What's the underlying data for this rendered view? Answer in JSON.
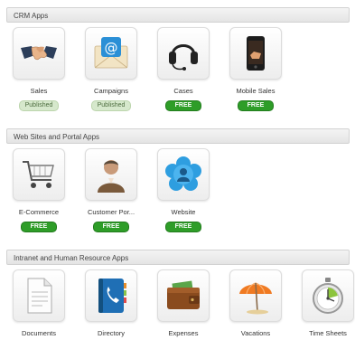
{
  "sections": [
    {
      "title": "CRM Apps"
    },
    {
      "title": "Web Sites and Portal Apps"
    },
    {
      "title": "Intranet and Human Resource Apps"
    }
  ],
  "crm_apps": [
    {
      "name": "Sales",
      "badge": "Published",
      "icon": "handshake-icon"
    },
    {
      "name": "Campaigns",
      "badge": "Published",
      "icon": "email-envelope-icon"
    },
    {
      "name": "Cases",
      "badge": "FREE",
      "icon": "headset-icon"
    },
    {
      "name": "Mobile Sales",
      "badge": "FREE",
      "icon": "smartphone-icon"
    }
  ],
  "web_apps": [
    {
      "name": "E-Commerce",
      "badge": "FREE",
      "icon": "shopping-cart-icon"
    },
    {
      "name": "Customer Por...",
      "badge": "FREE",
      "icon": "customer-person-icon"
    },
    {
      "name": "Website",
      "badge": "FREE",
      "icon": "website-flower-icon"
    }
  ],
  "intranet_apps": [
    {
      "name": "Documents",
      "icon": "document-icon"
    },
    {
      "name": "Directory",
      "icon": "phone-book-icon"
    },
    {
      "name": "Expenses",
      "icon": "wallet-icon"
    },
    {
      "name": "Vacations",
      "icon": "beach-umbrella-icon"
    },
    {
      "name": "Time Sheets",
      "icon": "stopwatch-icon"
    }
  ]
}
